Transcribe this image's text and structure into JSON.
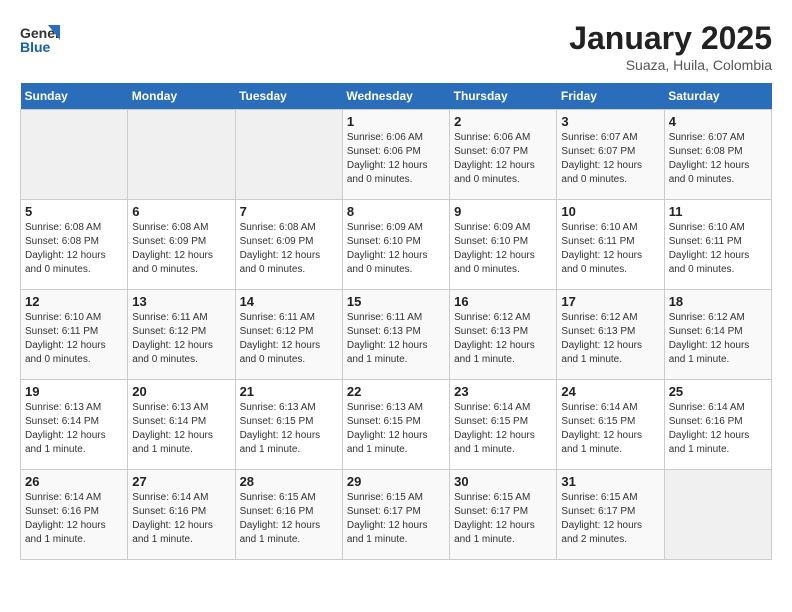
{
  "header": {
    "logo_general": "General",
    "logo_blue": "Blue",
    "month_year": "January 2025",
    "location": "Suaza, Huila, Colombia"
  },
  "days_of_week": [
    "Sunday",
    "Monday",
    "Tuesday",
    "Wednesday",
    "Thursday",
    "Friday",
    "Saturday"
  ],
  "weeks": [
    [
      {
        "day": "",
        "info": ""
      },
      {
        "day": "",
        "info": ""
      },
      {
        "day": "",
        "info": ""
      },
      {
        "day": "1",
        "info": "Sunrise: 6:06 AM\nSunset: 6:06 PM\nDaylight: 12 hours\nand 0 minutes."
      },
      {
        "day": "2",
        "info": "Sunrise: 6:06 AM\nSunset: 6:07 PM\nDaylight: 12 hours\nand 0 minutes."
      },
      {
        "day": "3",
        "info": "Sunrise: 6:07 AM\nSunset: 6:07 PM\nDaylight: 12 hours\nand 0 minutes."
      },
      {
        "day": "4",
        "info": "Sunrise: 6:07 AM\nSunset: 6:08 PM\nDaylight: 12 hours\nand 0 minutes."
      }
    ],
    [
      {
        "day": "5",
        "info": "Sunrise: 6:08 AM\nSunset: 6:08 PM\nDaylight: 12 hours\nand 0 minutes."
      },
      {
        "day": "6",
        "info": "Sunrise: 6:08 AM\nSunset: 6:09 PM\nDaylight: 12 hours\nand 0 minutes."
      },
      {
        "day": "7",
        "info": "Sunrise: 6:08 AM\nSunset: 6:09 PM\nDaylight: 12 hours\nand 0 minutes."
      },
      {
        "day": "8",
        "info": "Sunrise: 6:09 AM\nSunset: 6:10 PM\nDaylight: 12 hours\nand 0 minutes."
      },
      {
        "day": "9",
        "info": "Sunrise: 6:09 AM\nSunset: 6:10 PM\nDaylight: 12 hours\nand 0 minutes."
      },
      {
        "day": "10",
        "info": "Sunrise: 6:10 AM\nSunset: 6:11 PM\nDaylight: 12 hours\nand 0 minutes."
      },
      {
        "day": "11",
        "info": "Sunrise: 6:10 AM\nSunset: 6:11 PM\nDaylight: 12 hours\nand 0 minutes."
      }
    ],
    [
      {
        "day": "12",
        "info": "Sunrise: 6:10 AM\nSunset: 6:11 PM\nDaylight: 12 hours\nand 0 minutes."
      },
      {
        "day": "13",
        "info": "Sunrise: 6:11 AM\nSunset: 6:12 PM\nDaylight: 12 hours\nand 0 minutes."
      },
      {
        "day": "14",
        "info": "Sunrise: 6:11 AM\nSunset: 6:12 PM\nDaylight: 12 hours\nand 0 minutes."
      },
      {
        "day": "15",
        "info": "Sunrise: 6:11 AM\nSunset: 6:13 PM\nDaylight: 12 hours\nand 1 minute."
      },
      {
        "day": "16",
        "info": "Sunrise: 6:12 AM\nSunset: 6:13 PM\nDaylight: 12 hours\nand 1 minute."
      },
      {
        "day": "17",
        "info": "Sunrise: 6:12 AM\nSunset: 6:13 PM\nDaylight: 12 hours\nand 1 minute."
      },
      {
        "day": "18",
        "info": "Sunrise: 6:12 AM\nSunset: 6:14 PM\nDaylight: 12 hours\nand 1 minute."
      }
    ],
    [
      {
        "day": "19",
        "info": "Sunrise: 6:13 AM\nSunset: 6:14 PM\nDaylight: 12 hours\nand 1 minute."
      },
      {
        "day": "20",
        "info": "Sunrise: 6:13 AM\nSunset: 6:14 PM\nDaylight: 12 hours\nand 1 minute."
      },
      {
        "day": "21",
        "info": "Sunrise: 6:13 AM\nSunset: 6:15 PM\nDaylight: 12 hours\nand 1 minute."
      },
      {
        "day": "22",
        "info": "Sunrise: 6:13 AM\nSunset: 6:15 PM\nDaylight: 12 hours\nand 1 minute."
      },
      {
        "day": "23",
        "info": "Sunrise: 6:14 AM\nSunset: 6:15 PM\nDaylight: 12 hours\nand 1 minute."
      },
      {
        "day": "24",
        "info": "Sunrise: 6:14 AM\nSunset: 6:15 PM\nDaylight: 12 hours\nand 1 minute."
      },
      {
        "day": "25",
        "info": "Sunrise: 6:14 AM\nSunset: 6:16 PM\nDaylight: 12 hours\nand 1 minute."
      }
    ],
    [
      {
        "day": "26",
        "info": "Sunrise: 6:14 AM\nSunset: 6:16 PM\nDaylight: 12 hours\nand 1 minute."
      },
      {
        "day": "27",
        "info": "Sunrise: 6:14 AM\nSunset: 6:16 PM\nDaylight: 12 hours\nand 1 minute."
      },
      {
        "day": "28",
        "info": "Sunrise: 6:15 AM\nSunset: 6:16 PM\nDaylight: 12 hours\nand 1 minute."
      },
      {
        "day": "29",
        "info": "Sunrise: 6:15 AM\nSunset: 6:17 PM\nDaylight: 12 hours\nand 1 minute."
      },
      {
        "day": "30",
        "info": "Sunrise: 6:15 AM\nSunset: 6:17 PM\nDaylight: 12 hours\nand 1 minute."
      },
      {
        "day": "31",
        "info": "Sunrise: 6:15 AM\nSunset: 6:17 PM\nDaylight: 12 hours\nand 2 minutes."
      },
      {
        "day": "",
        "info": ""
      }
    ]
  ]
}
